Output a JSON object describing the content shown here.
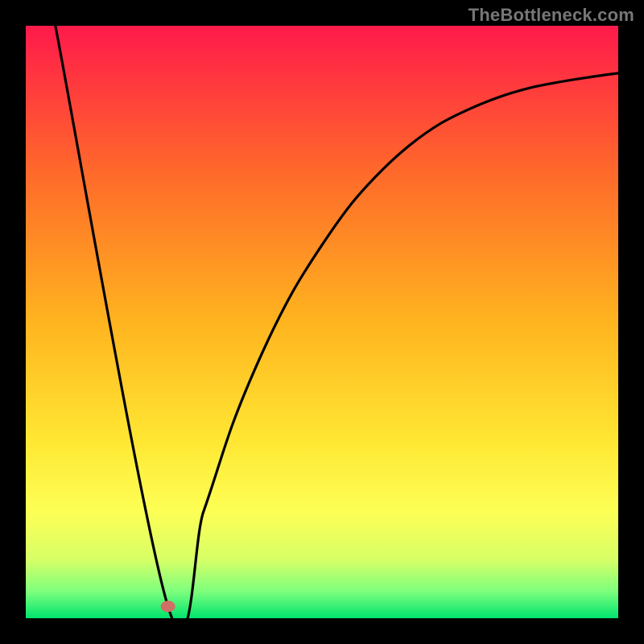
{
  "attribution": "TheBottleneck.com",
  "chart_data": {
    "type": "line",
    "title": "",
    "xlabel": "",
    "ylabel": "",
    "xlim": [
      0,
      100
    ],
    "ylim": [
      0,
      100
    ],
    "grid": false,
    "legend": false,
    "gradient_stops": [
      {
        "offset": 0.0,
        "color": "#ff1a4b"
      },
      {
        "offset": 0.25,
        "color": "#ff6a2a"
      },
      {
        "offset": 0.5,
        "color": "#ffb41f"
      },
      {
        "offset": 0.7,
        "color": "#ffe733"
      },
      {
        "offset": 0.82,
        "color": "#fdff55"
      },
      {
        "offset": 0.9,
        "color": "#d8ff66"
      },
      {
        "offset": 0.955,
        "color": "#7dff7d"
      },
      {
        "offset": 1.0,
        "color": "#00e36e"
      }
    ],
    "marker": {
      "x": 24.0,
      "y": 2.0,
      "color": "#cf6f65"
    },
    "series": [
      {
        "name": "curve",
        "color": "#000000",
        "x": [
          5.0,
          24.0,
          30.0,
          35.0,
          40.0,
          45.0,
          50.0,
          55.0,
          60.0,
          65.0,
          70.0,
          75.0,
          80.0,
          85.0,
          90.0,
          95.0,
          100.0
        ],
        "y": [
          100.0,
          2.0,
          18.0,
          33.0,
          45.0,
          55.0,
          63.0,
          70.0,
          75.5,
          80.0,
          83.5,
          86.0,
          88.0,
          89.5,
          90.5,
          91.3,
          92.0
        ]
      }
    ]
  }
}
